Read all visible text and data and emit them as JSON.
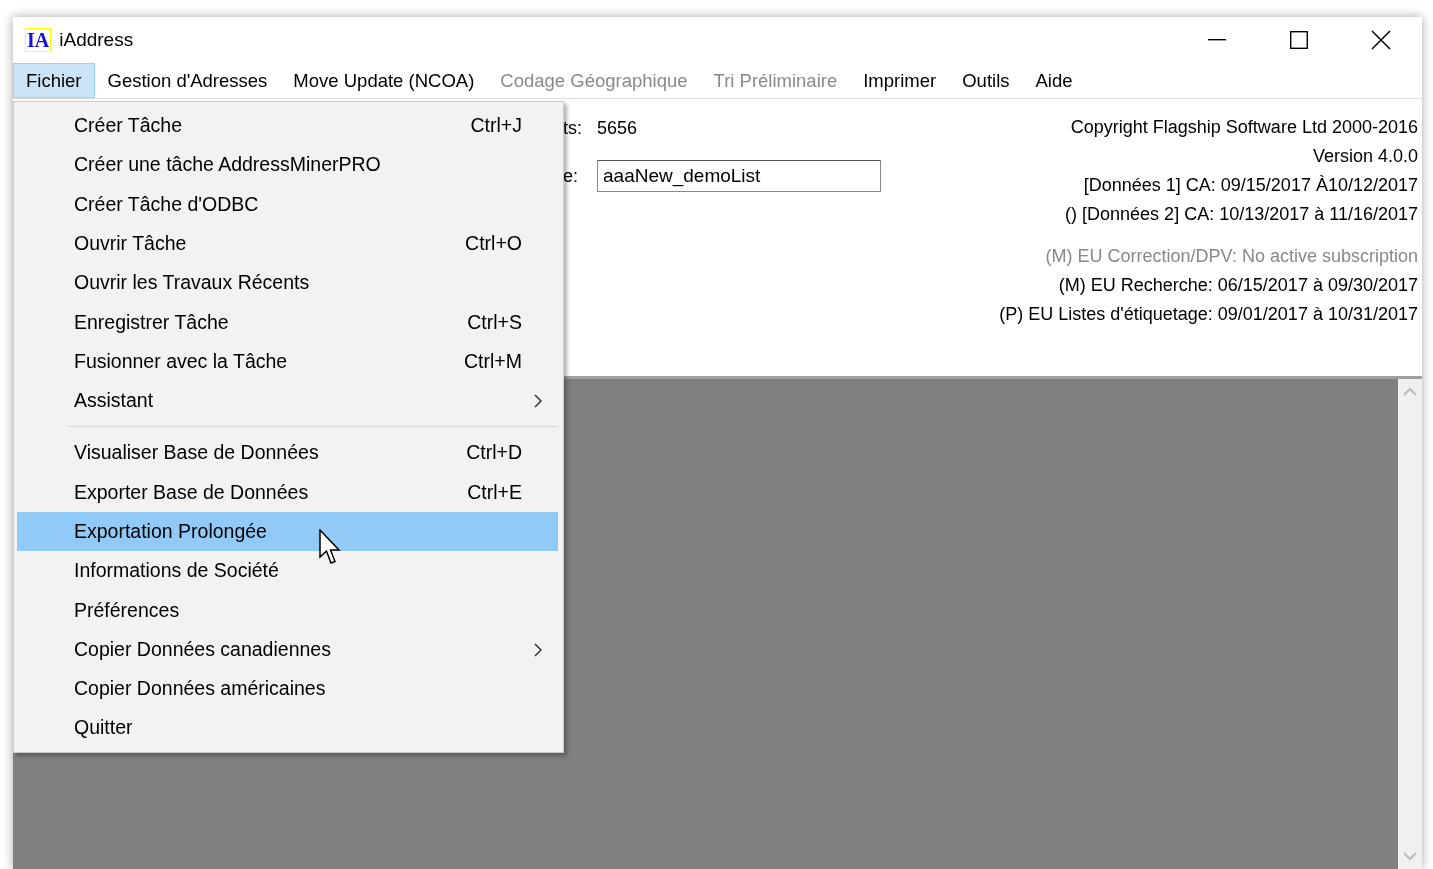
{
  "window": {
    "title": "iAddress",
    "logo": "IA"
  },
  "menubar": [
    {
      "label": "Fichier",
      "selected": true,
      "disabled": false
    },
    {
      "label": "Gestion d'Adresses",
      "selected": false,
      "disabled": false
    },
    {
      "label": "Move Update (NCOA)",
      "selected": false,
      "disabled": false
    },
    {
      "label": "Codage Géographique",
      "selected": false,
      "disabled": true
    },
    {
      "label": "Tri Préliminaire",
      "selected": false,
      "disabled": true
    },
    {
      "label": "Imprimer",
      "selected": false,
      "disabled": false
    },
    {
      "label": "Outils",
      "selected": false,
      "disabled": false
    },
    {
      "label": "Aide",
      "selected": false,
      "disabled": false
    }
  ],
  "fields": [
    {
      "label": "ts:",
      "value": "5656",
      "kind": "text"
    },
    {
      "label": "e:",
      "value": "aaaNew_demoList",
      "kind": "input"
    }
  ],
  "info_lines": [
    {
      "text": "Copyright Flagship Software Ltd 2000-2016",
      "disabled": false
    },
    {
      "text": "Version 4.0.0",
      "disabled": false
    },
    {
      "text": "[Données 1] CA: 09/15/2017 À10/12/2017",
      "disabled": false
    },
    {
      "text": "() [Données 2] CA: 10/13/2017 à 11/16/2017",
      "disabled": false
    },
    {
      "text": "(M) EU Correction/DPV: No active subscription",
      "disabled": true
    },
    {
      "text": "(M) EU Recherche: 06/15/2017 à 09/30/2017",
      "disabled": false
    },
    {
      "text": "(P) EU Listes d'étiquetage: 09/01/2017 à 10/31/2017",
      "disabled": false
    }
  ],
  "dropdown": [
    {
      "kind": "item",
      "label": "Créer Tâche",
      "shortcut": "Ctrl+J",
      "submenu": false,
      "selected": false
    },
    {
      "kind": "item",
      "label": "Créer une tâche AddressMinerPRO",
      "submenu": false,
      "selected": false
    },
    {
      "kind": "item",
      "label": "Créer Tâche d'ODBC",
      "submenu": false,
      "selected": false
    },
    {
      "kind": "item",
      "label": "Ouvrir Tâche",
      "shortcut": "Ctrl+O",
      "submenu": false,
      "selected": false
    },
    {
      "kind": "item",
      "label": "Ouvrir les Travaux Récents",
      "submenu": false,
      "selected": false
    },
    {
      "kind": "item",
      "label": "Enregistrer Tâche",
      "shortcut": "Ctrl+S",
      "submenu": false,
      "selected": false
    },
    {
      "kind": "item",
      "label": "Fusionner avec la Tâche",
      "shortcut": "Ctrl+M",
      "submenu": false,
      "selected": false
    },
    {
      "kind": "item",
      "label": "Assistant",
      "submenu": true,
      "selected": false
    },
    {
      "kind": "separator"
    },
    {
      "kind": "item",
      "label": "Visualiser Base de Données",
      "shortcut": "Ctrl+D",
      "submenu": false,
      "selected": false
    },
    {
      "kind": "item",
      "label": "Exporter Base de Données",
      "shortcut": "Ctrl+E",
      "submenu": false,
      "selected": false
    },
    {
      "kind": "item",
      "label": "Exportation Prolongée",
      "submenu": false,
      "selected": true
    },
    {
      "kind": "item",
      "label": "Informations de Société",
      "submenu": false,
      "selected": false
    },
    {
      "kind": "item",
      "label": "Préférences",
      "submenu": false,
      "selected": false
    },
    {
      "kind": "item",
      "label": "Copier Données canadiennes",
      "submenu": true,
      "selected": false
    },
    {
      "kind": "item",
      "label": "Copier Données américaines",
      "submenu": false,
      "selected": false
    },
    {
      "kind": "item",
      "label": "Quitter",
      "submenu": false,
      "selected": false
    }
  ]
}
